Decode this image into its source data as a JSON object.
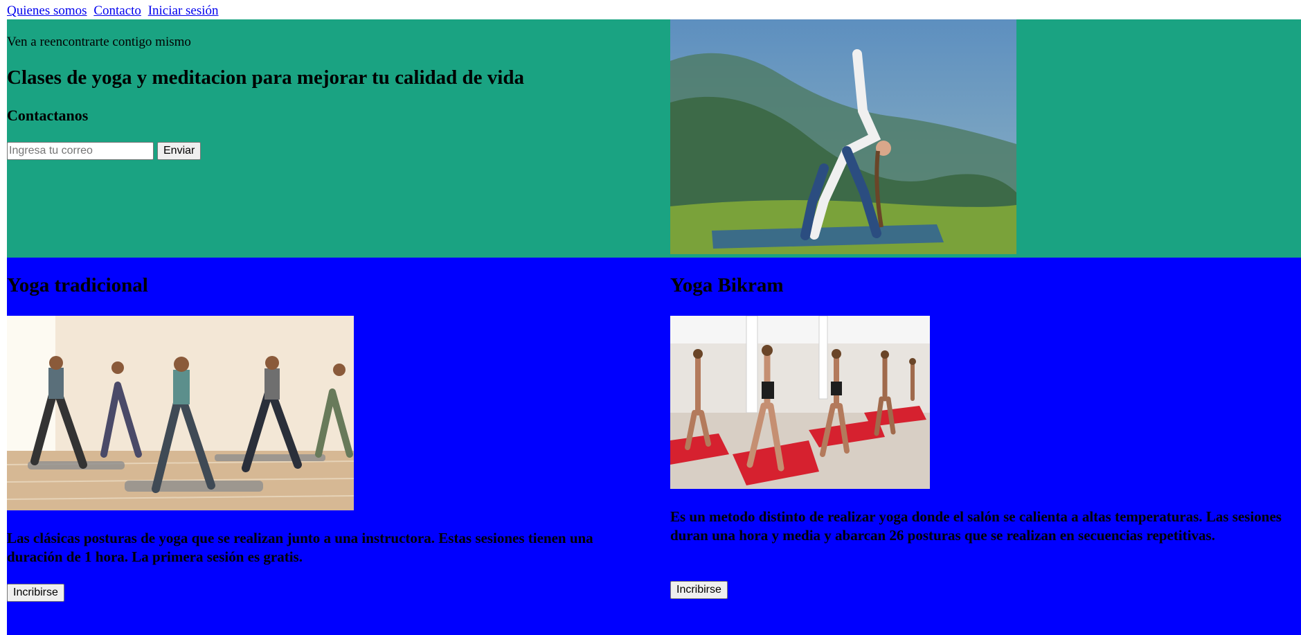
{
  "nav": {
    "links": [
      "Quienes somos",
      "Contacto",
      "Iniciar sesión"
    ]
  },
  "hero": {
    "tagline": "Ven a reencontrarte contigo mismo",
    "title": "Clases de yoga y meditacion para mejorar tu calidad de vida",
    "contact_heading": "Contactanos",
    "email_placeholder": "Ingresa tu correo",
    "send_label": "Enviar"
  },
  "classes": [
    {
      "name": "Yoga tradicional",
      "description": "Las clásicas posturas de yoga que se realizan junto a una instructora. Estas sesiones tienen una duración de 1 hora. La primera sesión es gratis.",
      "button": "Incribirse"
    },
    {
      "name": "Yoga Bikram",
      "description": "Es un metodo distinto de realizar yoga donde el salón se calienta a altas temperaturas. Las sesiones duran una hora y media y abarcan 26 posturas que se realizan en secuencias repetitivas.",
      "button": "Incribirse"
    }
  ],
  "colors": {
    "hero_bg": "#1aa382",
    "classes_bg": "#0000ff",
    "link": "#0000ee"
  }
}
